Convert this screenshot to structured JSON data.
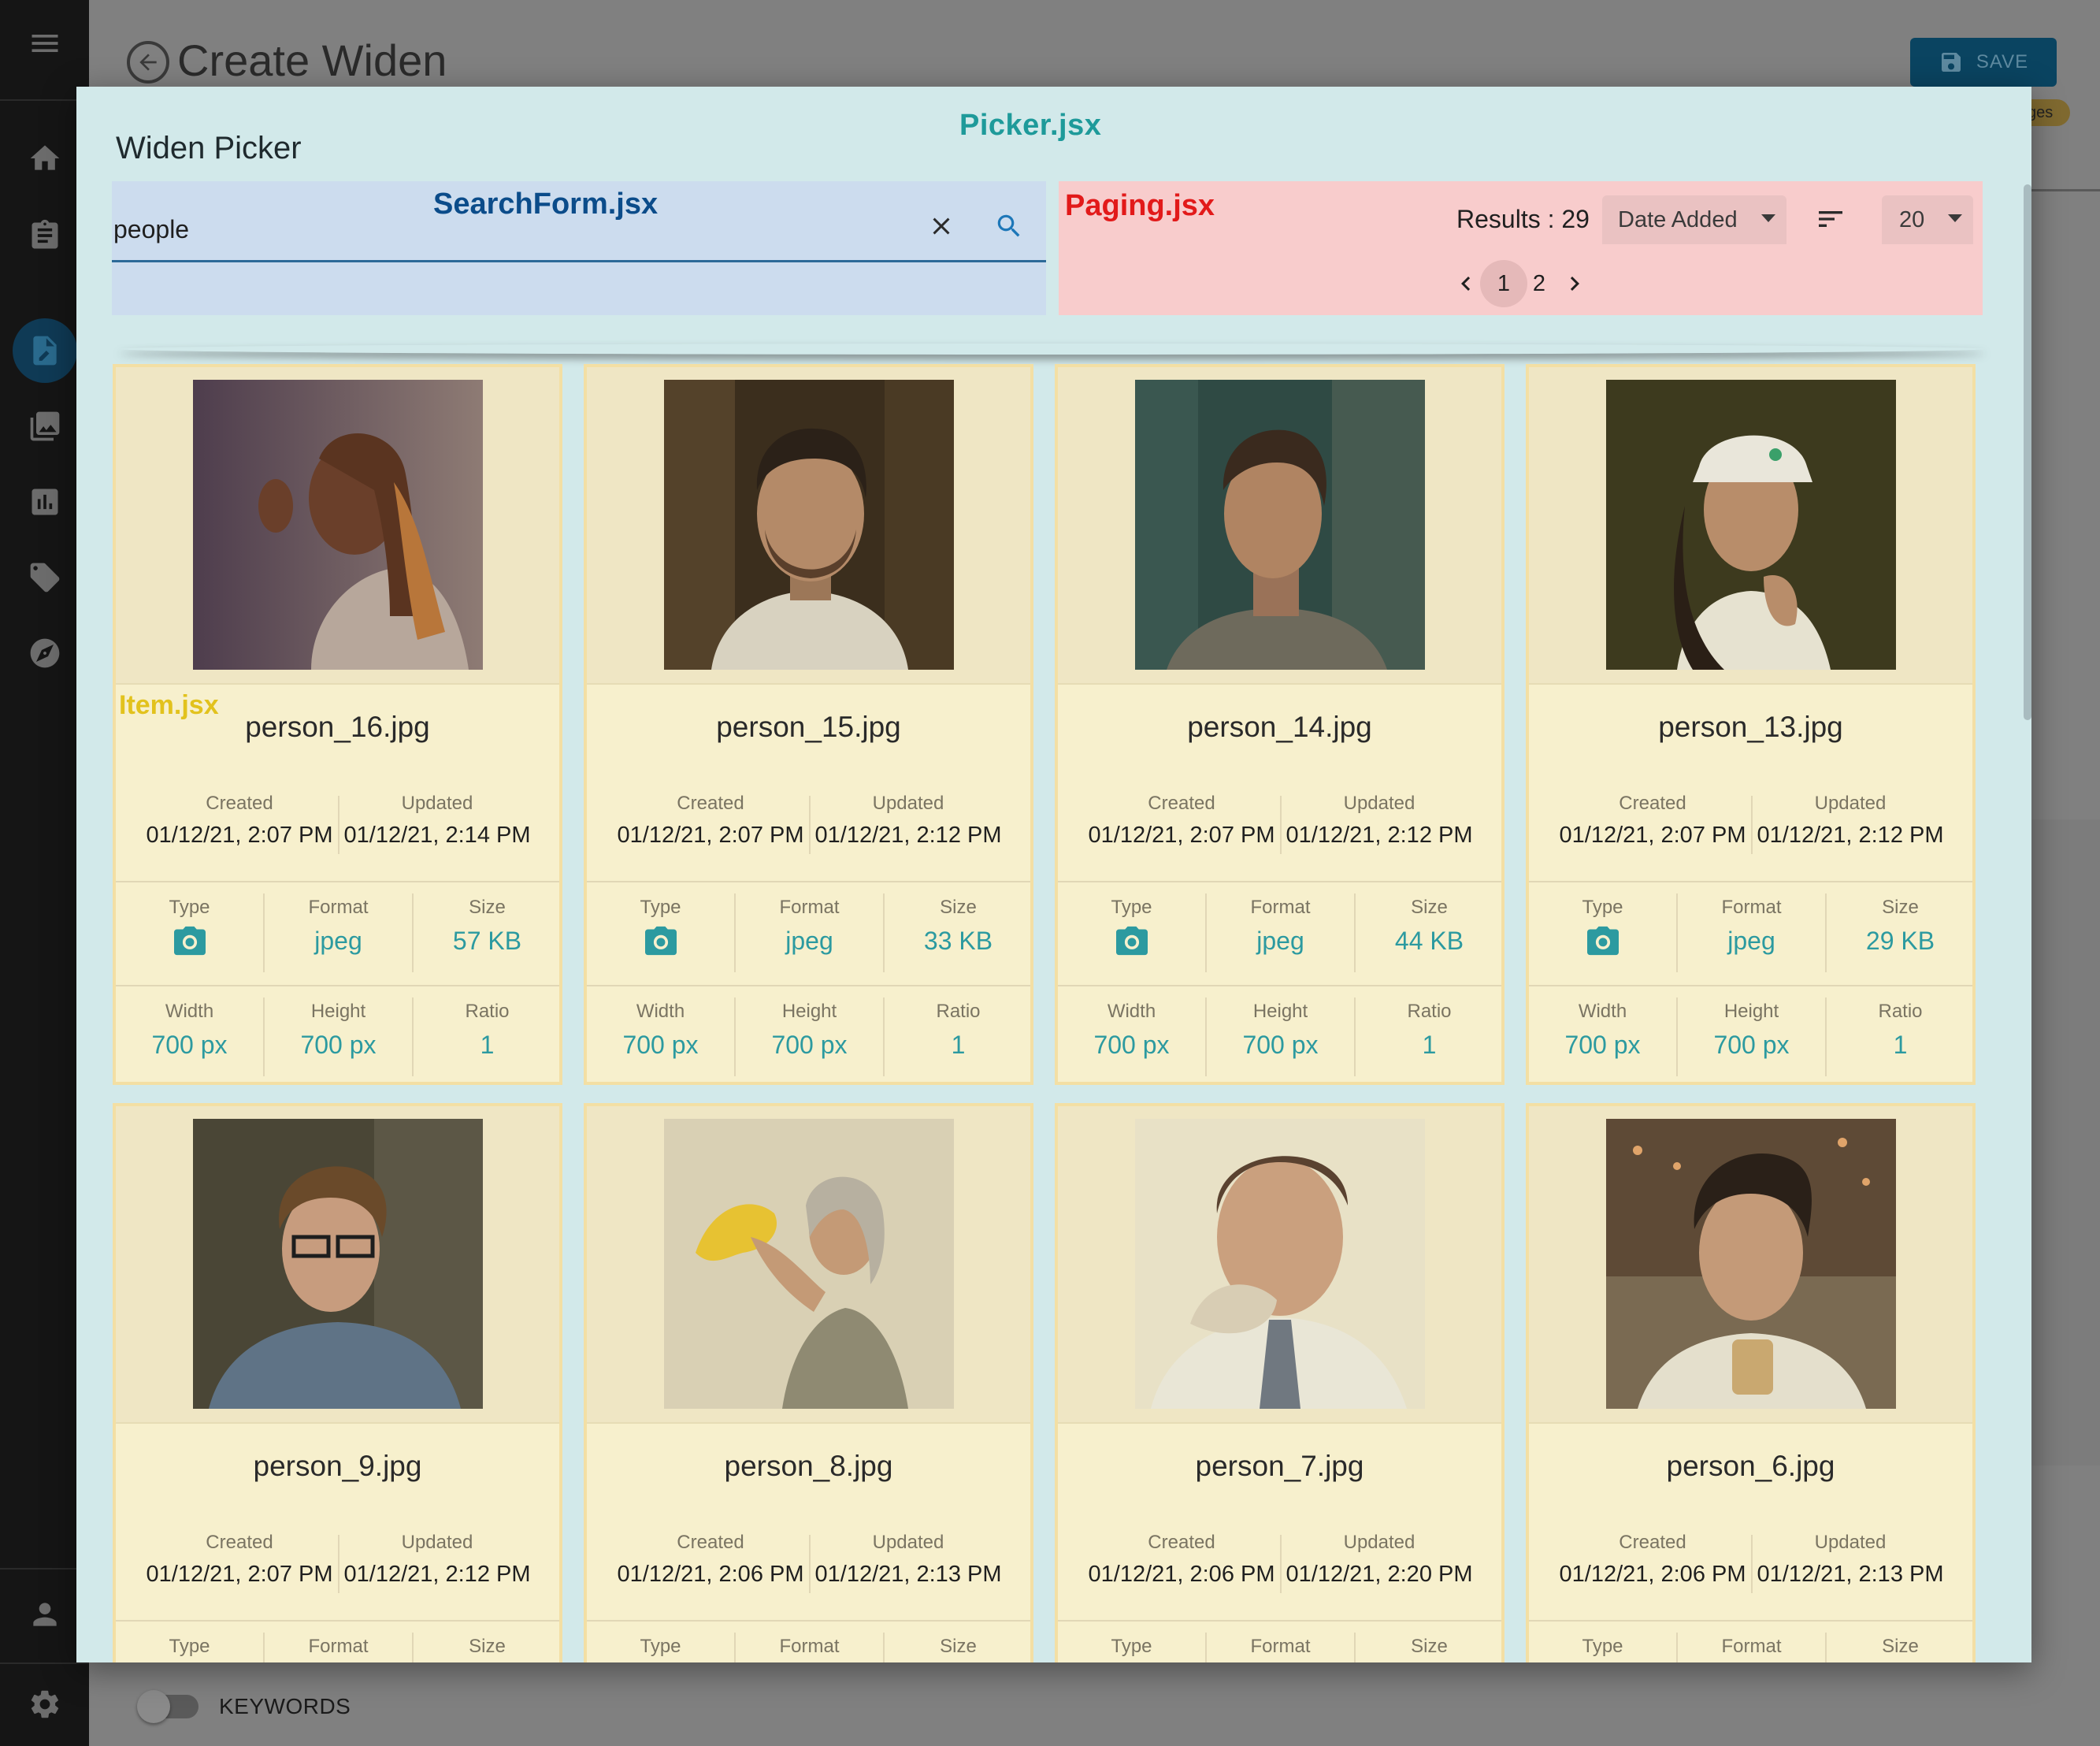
{
  "app": {
    "page_title": "Create Widen",
    "save_label": "SAVE",
    "chip_peek": "ges",
    "keywords_label": "KEYWORDS"
  },
  "sidebar": {
    "items": [
      {
        "icon": "menu-icon"
      },
      {
        "icon": "home-icon"
      },
      {
        "icon": "clipboard-icon"
      },
      {
        "icon": "edit-document-icon",
        "active": true
      },
      {
        "icon": "photo-library-icon"
      },
      {
        "icon": "bar-chart-icon"
      },
      {
        "icon": "tag-icon"
      },
      {
        "icon": "compass-icon"
      },
      {
        "icon": "person-icon"
      },
      {
        "icon": "settings-gear-icon"
      }
    ]
  },
  "modal": {
    "component_tag": "Picker.jsx",
    "title": "Widen Picker",
    "search": {
      "component_tag": "SearchForm.jsx",
      "value": "people"
    },
    "paging": {
      "component_tag": "Paging.jsx",
      "results_text": "Results : 29",
      "sort_by": "Date Added",
      "per_page": "20",
      "pages": [
        "1",
        "2"
      ],
      "current_page": "1"
    },
    "item_tag": "Item.jsx",
    "labels": {
      "created": "Created",
      "updated": "Updated",
      "type": "Type",
      "format": "Format",
      "size": "Size",
      "width": "Width",
      "height": "Height",
      "ratio": "Ratio"
    },
    "items": [
      {
        "name": "person_16.jpg",
        "created": "01/12/21, 2:07 PM",
        "updated": "01/12/21, 2:14 PM",
        "format": "jpeg",
        "size": "57 KB",
        "width": "700 px",
        "height": "700 px",
        "ratio": "1"
      },
      {
        "name": "person_15.jpg",
        "created": "01/12/21, 2:07 PM",
        "updated": "01/12/21, 2:12 PM",
        "format": "jpeg",
        "size": "33 KB",
        "width": "700 px",
        "height": "700 px",
        "ratio": "1"
      },
      {
        "name": "person_14.jpg",
        "created": "01/12/21, 2:07 PM",
        "updated": "01/12/21, 2:12 PM",
        "format": "jpeg",
        "size": "44 KB",
        "width": "700 px",
        "height": "700 px",
        "ratio": "1"
      },
      {
        "name": "person_13.jpg",
        "created": "01/12/21, 2:07 PM",
        "updated": "01/12/21, 2:12 PM",
        "format": "jpeg",
        "size": "29 KB",
        "width": "700 px",
        "height": "700 px",
        "ratio": "1"
      },
      {
        "name": "person_9.jpg",
        "created": "01/12/21, 2:07 PM",
        "updated": "01/12/21, 2:12 PM"
      },
      {
        "name": "person_8.jpg",
        "created": "01/12/21, 2:06 PM",
        "updated": "01/12/21, 2:13 PM"
      },
      {
        "name": "person_7.jpg",
        "created": "01/12/21, 2:06 PM",
        "updated": "01/12/21, 2:20 PM"
      },
      {
        "name": "person_6.jpg",
        "created": "01/12/21, 2:06 PM",
        "updated": "01/12/21, 2:13 PM"
      }
    ]
  }
}
